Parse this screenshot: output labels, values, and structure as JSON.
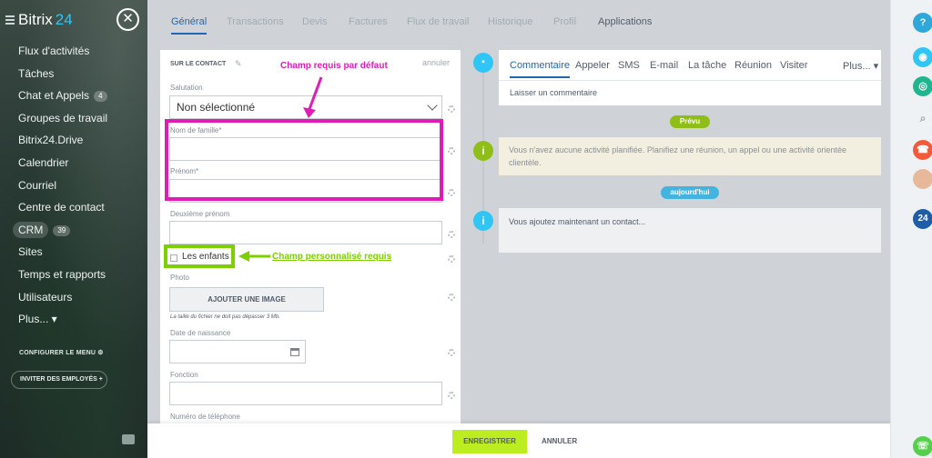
{
  "sidebar": {
    "logo_text": "Bitrix",
    "logo_num": "24",
    "close_glyph": "✕",
    "items": [
      {
        "label": "Flux d'activités"
      },
      {
        "label": "Tâches"
      },
      {
        "label": "Chat et Appels",
        "counter": "4"
      },
      {
        "label": "Groupes de travail"
      },
      {
        "label": "Bitrix24.Drive"
      },
      {
        "label": "Calendrier"
      },
      {
        "label": "Courriel"
      },
      {
        "label": "Centre de contact"
      },
      {
        "label": "CRM",
        "counter": "39"
      },
      {
        "label": "Sites"
      },
      {
        "label": "Temps et rapports"
      },
      {
        "label": "Utilisateurs"
      },
      {
        "label": "Plus... ▾"
      }
    ],
    "configure_label": "CONFIGURER LE MENU",
    "invite_label": "INVITER DES EMPLOYÉS +"
  },
  "tabs": [
    "Général",
    "Transactions",
    "Devis",
    "Factures",
    "Flux de travail",
    "Historique",
    "Profil",
    "Applications"
  ],
  "form": {
    "header": "SUR LE CONTACT",
    "cancel_link": "annuler",
    "salutation_label": "Salutation",
    "salutation_value": "Non sélectionné",
    "last_name_label": "Nom de famille*",
    "first_name_label": "Prénom*",
    "middle_name_label": "Deuxième prénom",
    "children_label": "Les enfants",
    "photo_label": "Photo",
    "photo_button": "AJOUTER UNE IMAGE",
    "photo_hint": "La taille du fichier ne doit pas dépasser 3 Mb.",
    "birth_label": "Date de naissance",
    "function_label": "Fonction",
    "phone_label": "Numéro de téléphone"
  },
  "annotations": {
    "required_default": "Champ requis par défaut",
    "custom_required": "Champ personnalisé requis"
  },
  "timeline": {
    "editor_tabs": [
      "Commentaire",
      "Appeler",
      "SMS",
      "E-mail",
      "La tâche",
      "Réunion",
      "Visiter",
      "Plus... ▾"
    ],
    "comment_placeholder": "Laisser un commentaire",
    "planned_badge": "Prévu",
    "planned_note": "Vous n'avez aucune activité planifiée. Planifiez une réunion, un appel ou une activité orientée clientèle.",
    "today_badge": "aujourd'hui",
    "today_note": "Vous ajoutez maintenant un contact..."
  },
  "footer": {
    "save": "ENREGISTRER",
    "cancel": "ANNULER"
  },
  "right_bar": {
    "help": "?",
    "logo_24": "24"
  },
  "colors": {
    "accent_blue": "#2067b0",
    "save_green": "#bbed21",
    "annotation_pink": "#e21bb7",
    "annotation_green": "#7ccf00",
    "timeline_green": "#8fbe18",
    "today_blue": "#43b4e0"
  }
}
